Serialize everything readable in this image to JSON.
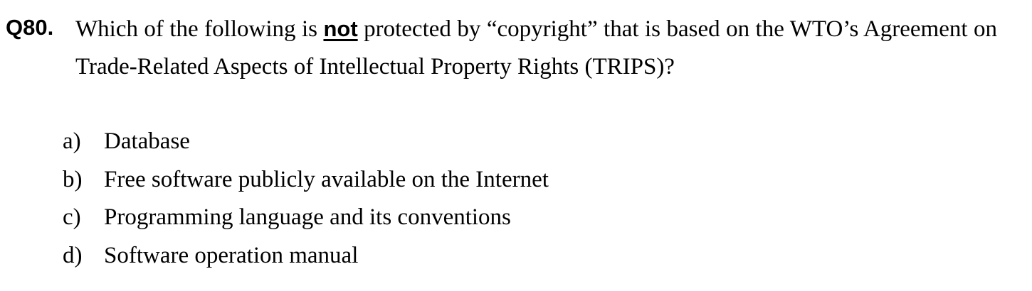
{
  "question": {
    "number": "Q80.",
    "text_before": "Which of the following is ",
    "emphasis": "not",
    "text_after": " protected by “copyright” that is based on the WTO’s Agreement on Trade-Related Aspects of Intellectual Property Rights (TRIPS)?"
  },
  "options": [
    {
      "letter": "a)",
      "text": "Database"
    },
    {
      "letter": "b)",
      "text": "Free software publicly available on the Internet"
    },
    {
      "letter": "c)",
      "text": "Programming language and its conventions"
    },
    {
      "letter": "d)",
      "text": "Software operation manual"
    }
  ]
}
